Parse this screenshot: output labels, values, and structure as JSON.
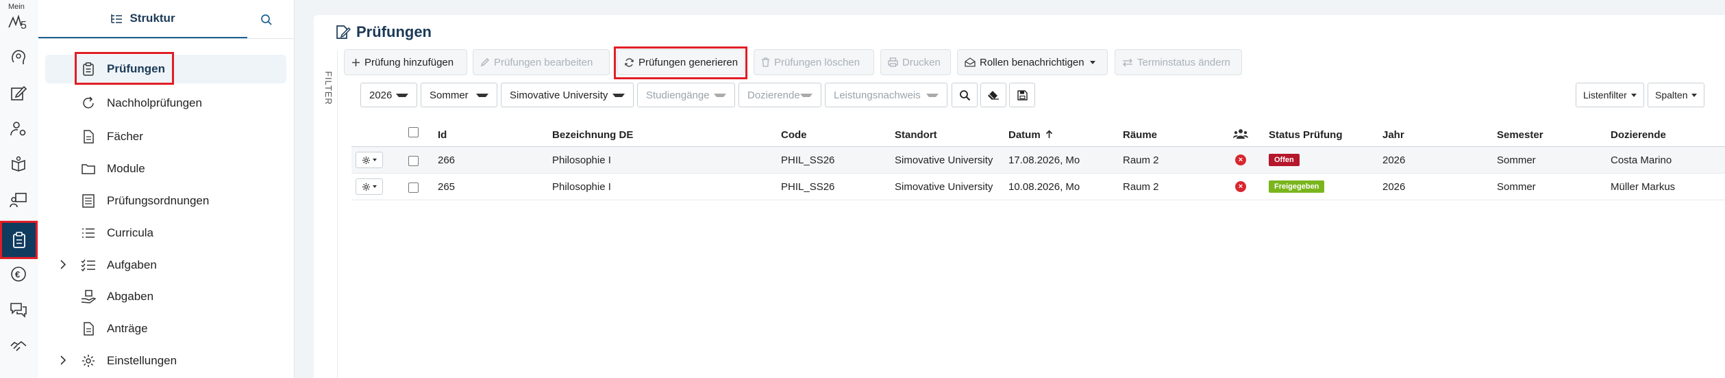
{
  "rail": {
    "logo_text": "Mein",
    "icons": [
      "lightbulb-head-icon",
      "edit-icon",
      "user-settings-icon",
      "book-hand-icon",
      "teacher-board-icon",
      "clipboard-icon",
      "euro-icon",
      "chat-icon",
      "handshake-icon"
    ]
  },
  "nav": {
    "tab_label": "Struktur",
    "items": [
      {
        "label": "Prüfungen",
        "icon": "clipboard-icon",
        "active": true
      },
      {
        "label": "Nachholprüfungen",
        "icon": "refresh-icon"
      },
      {
        "label": "Fächer",
        "icon": "document-icon"
      },
      {
        "label": "Module",
        "icon": "folder-icon"
      },
      {
        "label": "Prüfungsordnungen",
        "icon": "list-document-icon"
      },
      {
        "label": "Curricula",
        "icon": "list-icon"
      },
      {
        "label": "Aufgaben",
        "icon": "checklist-icon",
        "expandable": true
      },
      {
        "label": "Abgaben",
        "icon": "hand-package-icon"
      },
      {
        "label": "Anträge",
        "icon": "document-icon"
      },
      {
        "label": "Einstellungen",
        "icon": "gear-icon",
        "expandable": true
      }
    ]
  },
  "main": {
    "title": "Prüfungen",
    "filter_label": "FILTER",
    "toolbar": {
      "add": "Prüfung hinzufügen",
      "edit": "Prüfungen bearbeiten",
      "generate": "Prüfungen generieren",
      "delete": "Prüfungen löschen",
      "print": "Drucken",
      "notify": "Rollen benachrichtigen",
      "status": "Terminstatus ändern"
    },
    "filters": {
      "year": "2026",
      "semester": "Sommer",
      "university": "Simovative University",
      "studiengaenge": "Studiengänge",
      "dozierende": "Dozierende",
      "leistungsnachweis": "Leistungsnachweis"
    },
    "list_filter": "Listenfilter",
    "columns_btn": "Spalten"
  },
  "table": {
    "headers": {
      "id": "Id",
      "bezeichnung": "Bezeichnung DE",
      "code": "Code",
      "standort": "Standort",
      "datum": "Datum",
      "raeume": "Räume",
      "status": "Status Prüfung",
      "jahr": "Jahr",
      "semester": "Semester",
      "dozierende": "Dozierende"
    },
    "rows": [
      {
        "id": "266",
        "bezeichnung": "Philosophie I",
        "code": "PHIL_SS26",
        "standort": "Simovative University",
        "datum": "17.08.2026, Mo",
        "raeume": "Raum 2",
        "status": "Offen",
        "status_color": "#b5172d",
        "jahr": "2026",
        "semester": "Sommer",
        "dozierende": "Costa Marino"
      },
      {
        "id": "265",
        "bezeichnung": "Philosophie I",
        "code": "PHIL_SS26",
        "standort": "Simovative University",
        "datum": "10.08.2026, Mo",
        "raeume": "Raum 2",
        "status": "Freigegeben",
        "status_color": "#7ab51d",
        "jahr": "2026",
        "semester": "Sommer",
        "dozierende": "Müller Markus"
      }
    ]
  },
  "colors": {
    "accent": "#1c3a57",
    "highlight": "#e01e26",
    "rail_active": "#0f3b5f"
  }
}
